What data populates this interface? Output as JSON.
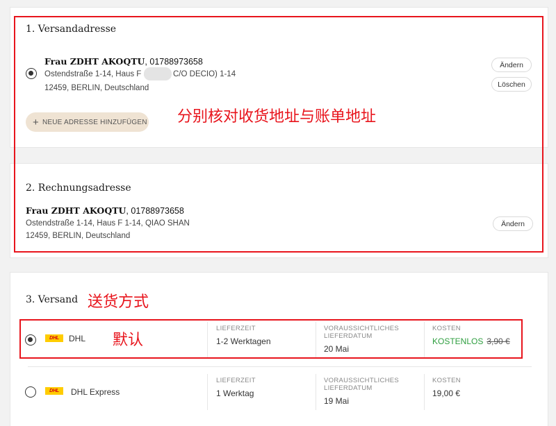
{
  "shipping_address": {
    "title": "1. Versandadresse",
    "name": "Frau ZDHT AKOQTU",
    "phone": ", 01788973658",
    "street_prefix": "Ostendstraße 1-14, Haus F (",
    "street_suffix": "C/O DECIO) 1-14",
    "city": "12459, BERLIN, Deutschland",
    "edit_label": "Ändern",
    "delete_label": "Löschen",
    "add_label": "NEUE ADRESSE HINZUFÜGEN"
  },
  "billing_address": {
    "title": "2. Rechnungsadresse",
    "name": "Frau ZDHT AKOQTU",
    "phone": ", 01788973658",
    "street": "Ostendstraße 1-14, Haus F 1-14, QIAO SHAN",
    "city": "12459, BERLIN, Deutschland",
    "edit_label": "Ändern"
  },
  "shipping": {
    "title": "3. Versand",
    "options": [
      {
        "carrier": "DHL",
        "logo_text": "DHL",
        "selected": true,
        "delivery_time_label": "LIEFERZEIT",
        "delivery_time": "1-2 Werktagen",
        "est_date_label_1": "VORAUSSICHTLICHES",
        "est_date_label_2": "LIEFERDATUM",
        "est_date": "20 Mai",
        "cost_label": "KOSTEN",
        "cost": "KOSTENLOS",
        "old_cost": "3,90 €"
      },
      {
        "carrier": "DHL Express",
        "logo_text": "DHL",
        "selected": false,
        "delivery_time_label": "LIEFERZEIT",
        "delivery_time": "1 Werktag",
        "est_date_label_1": "VORAUSSICHTLICHES",
        "est_date_label_2": "LIEFERDATUM",
        "est_date": "19 Mai",
        "cost_label": "KOSTEN",
        "cost": "19,00 €"
      }
    ]
  },
  "annotations": {
    "address_note": "分别核对收货地址与账单地址",
    "shipping_method_note": "送货方式",
    "default_note": "默认"
  },
  "colors": {
    "annotation_red": "#e8141c",
    "free_green": "#2e9e3f",
    "add_button_bg": "#efe3d3",
    "dhl_yellow": "#ffcc00",
    "dhl_red": "#d40511"
  }
}
